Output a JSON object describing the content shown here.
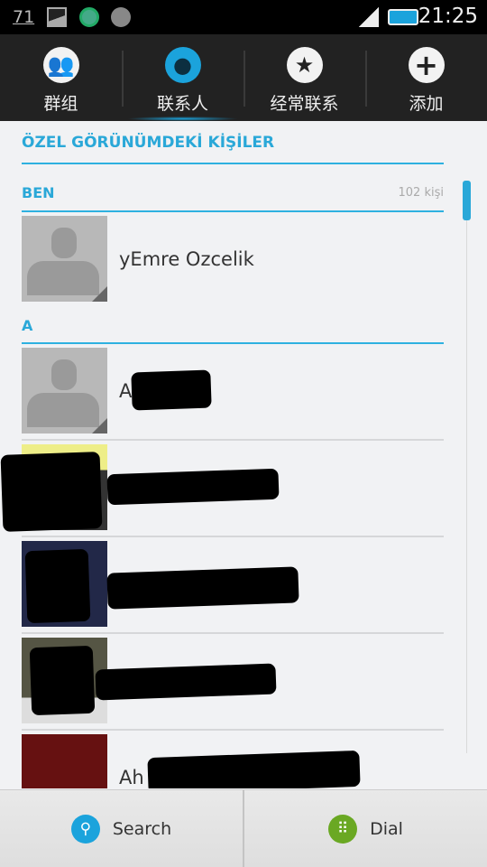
{
  "status_bar": {
    "notification_count": "71",
    "time": "21:25",
    "icons": [
      "image-icon",
      "sync-icon",
      "android-icon",
      "signal-icon",
      "battery-charging-icon"
    ]
  },
  "tabs": [
    {
      "label": "群组",
      "icon": "groups-icon"
    },
    {
      "label": "联系人",
      "icon": "person-icon",
      "active": true
    },
    {
      "label": "经常联系",
      "icon": "star-icon"
    },
    {
      "label": "添加",
      "icon": "plus-icon"
    }
  ],
  "list": {
    "title": "ÖZEL GÖRÜNÜMDEKİ KİŞİLER",
    "me_header": "BEN",
    "count": "102 kişi",
    "me_name": "yEmre Ozcelik",
    "section_a": "A",
    "contacts": [
      {
        "name": "A"
      },
      {
        "name": ""
      },
      {
        "name": ""
      },
      {
        "name": ""
      },
      {
        "name": "Ah"
      }
    ]
  },
  "bottom": {
    "search": "Search",
    "dial": "Dial"
  },
  "colors": {
    "accent": "#2aa8d8",
    "dial": "#6aa823"
  }
}
